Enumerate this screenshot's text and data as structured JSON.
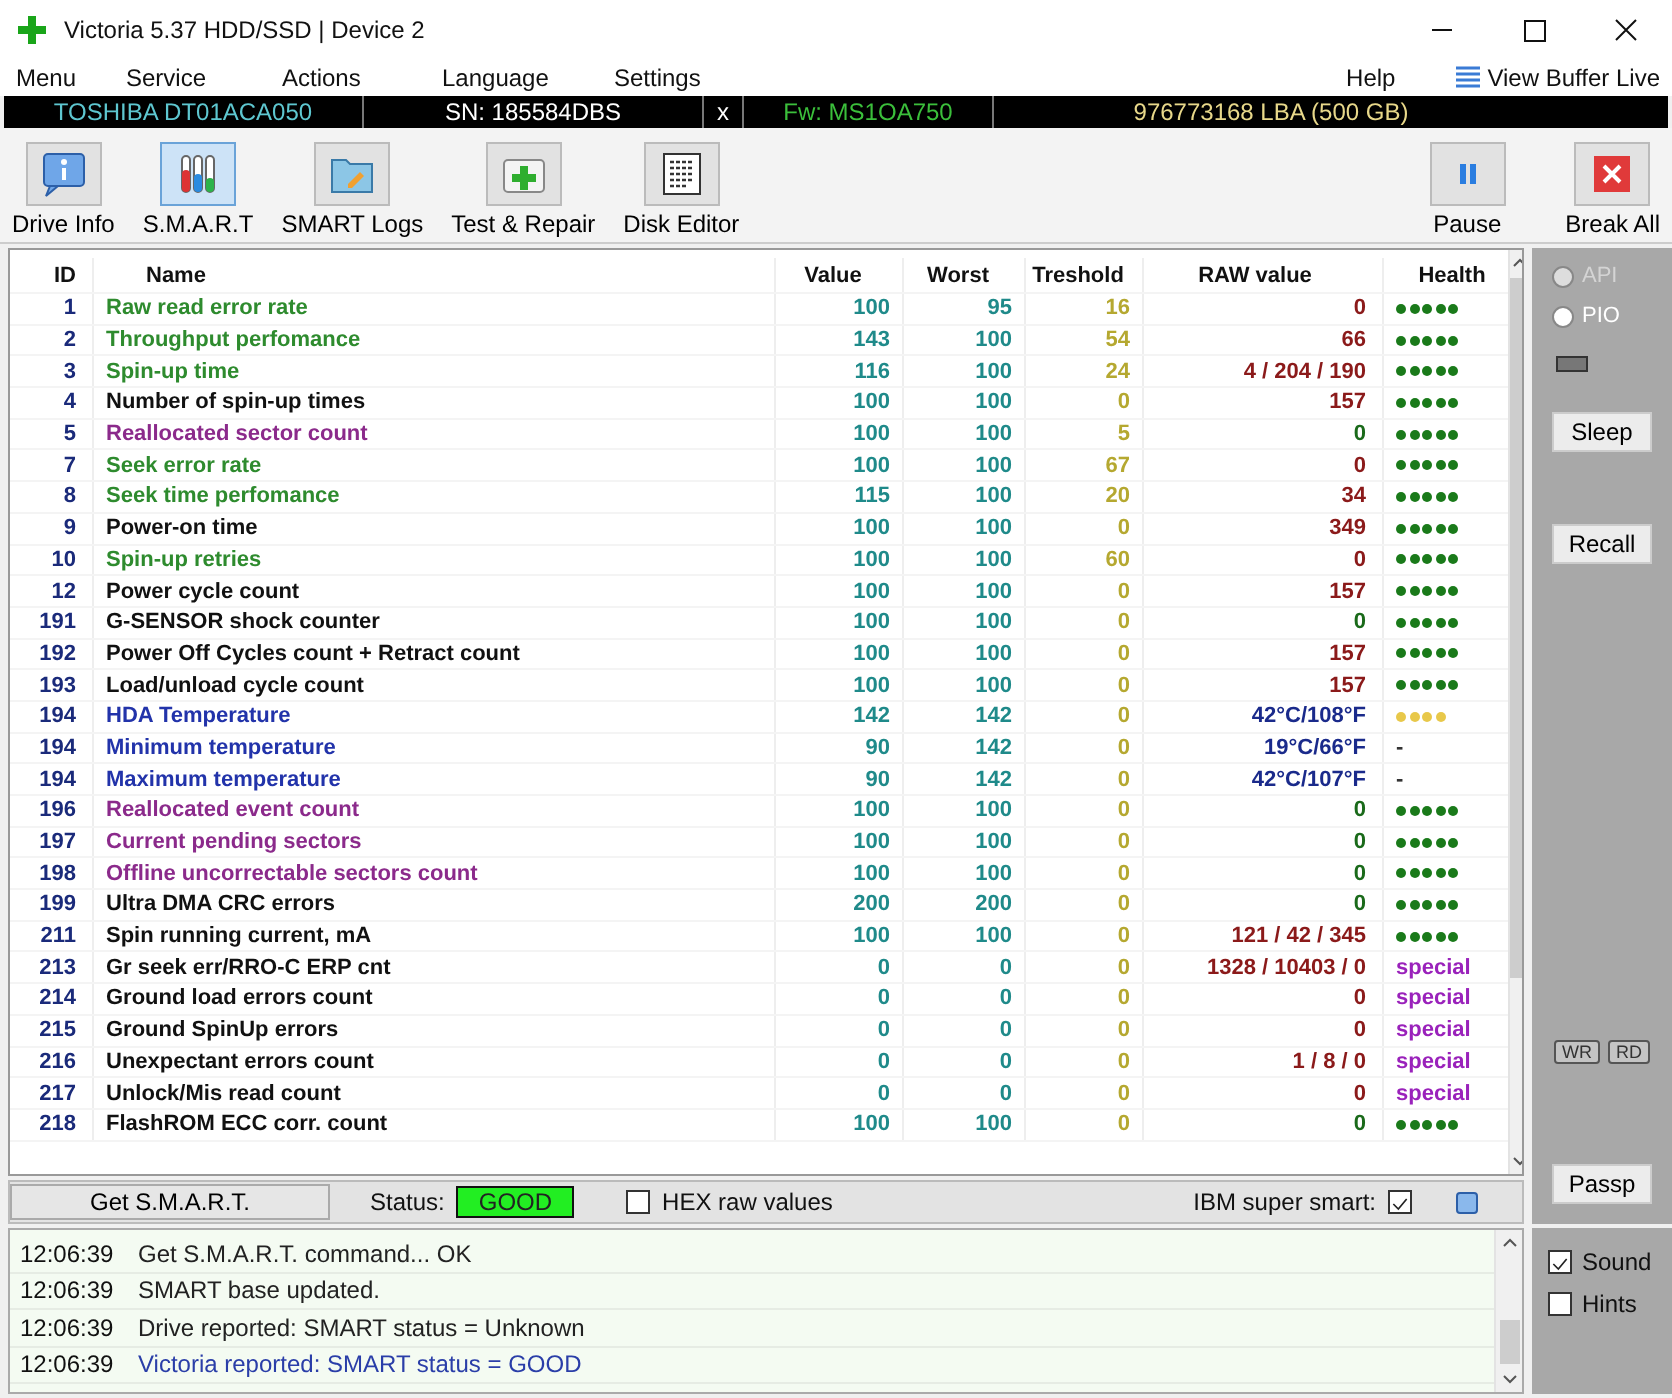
{
  "window": {
    "title": "Victoria 5.37 HDD/SSD | Device 2"
  },
  "menu": [
    "Menu",
    "Service",
    "Actions",
    "Language",
    "Settings"
  ],
  "menu_right": {
    "help": "Help",
    "view_buffer": "View Buffer Live"
  },
  "drive_bar": {
    "model": "TOSHIBA DT01ACA050",
    "serial": "SN: 185584DBS",
    "close": "x",
    "firmware": "Fw: MS1OA750",
    "capacity": "976773168 LBA (500 GB)"
  },
  "toolbar": [
    {
      "label": "Drive Info",
      "kind": "info",
      "selected": false
    },
    {
      "label": "S.M.A.R.T",
      "kind": "smart",
      "selected": true
    },
    {
      "label": "SMART Logs",
      "kind": "logs",
      "selected": false
    },
    {
      "label": "Test & Repair",
      "kind": "repair",
      "selected": false
    },
    {
      "label": "Disk Editor",
      "kind": "editor",
      "selected": false
    }
  ],
  "toolbar_right": [
    {
      "label": "Pause",
      "kind": "pause"
    },
    {
      "label": "Break All",
      "kind": "break"
    }
  ],
  "table": {
    "columns": [
      "ID",
      "Name",
      "Value",
      "Worst",
      "Treshold",
      "RAW value",
      "Health"
    ],
    "rows": [
      {
        "id": "1",
        "name": "Raw read error rate",
        "color": "#2e8b2e",
        "value": "100",
        "worst": "95",
        "threshold": "16",
        "raw": {
          "text": "0",
          "color": "#8b1a1a"
        },
        "health": {
          "kind": "dots",
          "stars": 5,
          "color": "#1a7a1a"
        }
      },
      {
        "id": "2",
        "name": "Throughput perfomance",
        "color": "#2e8b2e",
        "value": "143",
        "worst": "100",
        "threshold": "54",
        "raw": {
          "text": "66",
          "color": "#8b1a1a"
        },
        "health": {
          "kind": "dots",
          "stars": 5,
          "color": "#1a7a1a"
        }
      },
      {
        "id": "3",
        "name": "Spin-up time",
        "color": "#2e8b2e",
        "value": "116",
        "worst": "100",
        "threshold": "24",
        "raw": {
          "text": "4 / 204 / 190",
          "color": "#8b1a1a"
        },
        "health": {
          "kind": "dots",
          "stars": 5,
          "color": "#1a7a1a"
        }
      },
      {
        "id": "4",
        "name": "Number of spin-up times",
        "color": "#111111",
        "value": "100",
        "worst": "100",
        "threshold": "0",
        "raw": {
          "text": "157",
          "color": "#8b1a1a"
        },
        "health": {
          "kind": "dots",
          "stars": 5,
          "color": "#1a7a1a"
        }
      },
      {
        "id": "5",
        "name": "Reallocated sector count",
        "color": "#8b2a8b",
        "value": "100",
        "worst": "100",
        "threshold": "5",
        "raw": {
          "text": "0",
          "color": "#1a6a1a"
        },
        "health": {
          "kind": "dots",
          "stars": 5,
          "color": "#1a7a1a"
        }
      },
      {
        "id": "7",
        "name": "Seek error rate",
        "color": "#2e8b2e",
        "value": "100",
        "worst": "100",
        "threshold": "67",
        "raw": {
          "text": "0",
          "color": "#8b1a1a"
        },
        "health": {
          "kind": "dots",
          "stars": 5,
          "color": "#1a7a1a"
        }
      },
      {
        "id": "8",
        "name": "Seek time perfomance",
        "color": "#2e8b2e",
        "value": "115",
        "worst": "100",
        "threshold": "20",
        "raw": {
          "text": "34",
          "color": "#8b1a1a"
        },
        "health": {
          "kind": "dots",
          "stars": 5,
          "color": "#1a7a1a"
        }
      },
      {
        "id": "9",
        "name": "Power-on time",
        "color": "#111111",
        "value": "100",
        "worst": "100",
        "threshold": "0",
        "raw": {
          "text": "349",
          "color": "#8b1a1a"
        },
        "health": {
          "kind": "dots",
          "stars": 5,
          "color": "#1a7a1a"
        }
      },
      {
        "id": "10",
        "name": "Spin-up retries",
        "color": "#2e8b2e",
        "value": "100",
        "worst": "100",
        "threshold": "60",
        "raw": {
          "text": "0",
          "color": "#8b1a1a"
        },
        "health": {
          "kind": "dots",
          "stars": 5,
          "color": "#1a7a1a"
        }
      },
      {
        "id": "12",
        "name": "Power cycle count",
        "color": "#111111",
        "value": "100",
        "worst": "100",
        "threshold": "0",
        "raw": {
          "text": "157",
          "color": "#8b1a1a"
        },
        "health": {
          "kind": "dots",
          "stars": 5,
          "color": "#1a7a1a"
        }
      },
      {
        "id": "191",
        "name": "G-SENSOR shock counter",
        "color": "#111111",
        "value": "100",
        "worst": "100",
        "threshold": "0",
        "raw": {
          "text": "0",
          "color": "#1a6a1a"
        },
        "health": {
          "kind": "dots",
          "stars": 5,
          "color": "#1a7a1a"
        }
      },
      {
        "id": "192",
        "name": "Power Off Cycles count + Retract count",
        "color": "#111111",
        "value": "100",
        "worst": "100",
        "threshold": "0",
        "raw": {
          "text": "157",
          "color": "#8b1a1a"
        },
        "health": {
          "kind": "dots",
          "stars": 5,
          "color": "#1a7a1a"
        }
      },
      {
        "id": "193",
        "name": "Load/unload cycle count",
        "color": "#111111",
        "value": "100",
        "worst": "100",
        "threshold": "0",
        "raw": {
          "text": "157",
          "color": "#8b1a1a"
        },
        "health": {
          "kind": "dots",
          "stars": 5,
          "color": "#1a7a1a"
        }
      },
      {
        "id": "194",
        "name": "HDA Temperature",
        "color": "#2233aa",
        "value": "142",
        "worst": "142",
        "threshold": "0",
        "raw": {
          "text": "42°C/108°F",
          "color": "#1a2a8b"
        },
        "health": {
          "kind": "dots",
          "stars": 4,
          "color": "#e8c84a"
        }
      },
      {
        "id": "194",
        "name": "Minimum temperature",
        "color": "#2233aa",
        "value": "90",
        "worst": "142",
        "threshold": "0",
        "raw": {
          "text": "19°C/66°F",
          "color": "#1a2a8b"
        },
        "health": {
          "kind": "text",
          "text": "-",
          "color": "#333333"
        }
      },
      {
        "id": "194",
        "name": "Maximum temperature",
        "color": "#2233aa",
        "value": "90",
        "worst": "142",
        "threshold": "0",
        "raw": {
          "text": "42°C/107°F",
          "color": "#1a2a8b"
        },
        "health": {
          "kind": "text",
          "text": "-",
          "color": "#333333"
        }
      },
      {
        "id": "196",
        "name": "Reallocated event count",
        "color": "#8b2a8b",
        "value": "100",
        "worst": "100",
        "threshold": "0",
        "raw": {
          "text": "0",
          "color": "#1a6a1a"
        },
        "health": {
          "kind": "dots",
          "stars": 5,
          "color": "#1a7a1a"
        }
      },
      {
        "id": "197",
        "name": "Current pending sectors",
        "color": "#8b2a8b",
        "value": "100",
        "worst": "100",
        "threshold": "0",
        "raw": {
          "text": "0",
          "color": "#1a6a1a"
        },
        "health": {
          "kind": "dots",
          "stars": 5,
          "color": "#1a7a1a"
        }
      },
      {
        "id": "198",
        "name": "Offline uncorrectable sectors count",
        "color": "#8b2a8b",
        "value": "100",
        "worst": "100",
        "threshold": "0",
        "raw": {
          "text": "0",
          "color": "#1a6a1a"
        },
        "health": {
          "kind": "dots",
          "stars": 5,
          "color": "#1a7a1a"
        }
      },
      {
        "id": "199",
        "name": "Ultra DMA CRC errors",
        "color": "#111111",
        "value": "200",
        "worst": "200",
        "threshold": "0",
        "raw": {
          "text": "0",
          "color": "#1a6a1a"
        },
        "health": {
          "kind": "dots",
          "stars": 5,
          "color": "#1a7a1a"
        }
      },
      {
        "id": "211",
        "name": "Spin running current, mA",
        "color": "#111111",
        "value": "100",
        "worst": "100",
        "threshold": "0",
        "raw": {
          "text": "121 / 42 / 345",
          "color": "#8b1a1a"
        },
        "health": {
          "kind": "dots",
          "stars": 5,
          "color": "#1a7a1a"
        }
      },
      {
        "id": "213",
        "name": "Gr seek err/RRO-C ERP cnt",
        "color": "#111111",
        "value": "0",
        "worst": "0",
        "threshold": "0",
        "raw": {
          "text": "1328 / 10403 / 0",
          "color": "#8b1a1a"
        },
        "health": {
          "kind": "text",
          "text": "special",
          "color": "#9a22bb"
        }
      },
      {
        "id": "214",
        "name": "Ground load errors count",
        "color": "#111111",
        "value": "0",
        "worst": "0",
        "threshold": "0",
        "raw": {
          "text": "0",
          "color": "#8b1a1a"
        },
        "health": {
          "kind": "text",
          "text": "special",
          "color": "#9a22bb"
        }
      },
      {
        "id": "215",
        "name": "Ground SpinUp errors",
        "color": "#111111",
        "value": "0",
        "worst": "0",
        "threshold": "0",
        "raw": {
          "text": "0",
          "color": "#8b1a1a"
        },
        "health": {
          "kind": "text",
          "text": "special",
          "color": "#9a22bb"
        }
      },
      {
        "id": "216",
        "name": "Unexpectant errors count",
        "color": "#111111",
        "value": "0",
        "worst": "0",
        "threshold": "0",
        "raw": {
          "text": "1 / 8 / 0",
          "color": "#8b1a1a"
        },
        "health": {
          "kind": "text",
          "text": "special",
          "color": "#9a22bb"
        }
      },
      {
        "id": "217",
        "name": "Unlock/Mis read count",
        "color": "#111111",
        "value": "0",
        "worst": "0",
        "threshold": "0",
        "raw": {
          "text": "0",
          "color": "#8b1a1a"
        },
        "health": {
          "kind": "text",
          "text": "special",
          "color": "#9a22bb"
        }
      },
      {
        "id": "218",
        "name": "FlashROM ECC corr. count",
        "color": "#111111",
        "value": "100",
        "worst": "100",
        "threshold": "0",
        "raw": {
          "text": "0",
          "color": "#1a6a1a"
        },
        "health": {
          "kind": "dots",
          "stars": 5,
          "color": "#1a7a1a"
        }
      }
    ]
  },
  "status_row": {
    "button": "Get S.M.A.R.T.",
    "status_label": "Status:",
    "status": "GOOD",
    "hex": {
      "label": "HEX raw values",
      "checked": false
    },
    "ibm": {
      "label": "IBM super smart:",
      "checked": true
    }
  },
  "side_panel": {
    "radios": [
      {
        "label": "API",
        "selected": false,
        "disabled": true
      },
      {
        "label": "PIO",
        "selected": false,
        "disabled": false
      }
    ],
    "buttons": [
      "Sleep",
      "Recall"
    ],
    "indicators": [
      "WR",
      "RD"
    ],
    "passp": "Passp"
  },
  "log": [
    {
      "time": "12:06:39",
      "message": "Get S.M.A.R.T. command... OK",
      "kind": "normal"
    },
    {
      "time": "12:06:39",
      "message": "SMART base updated.",
      "kind": "normal"
    },
    {
      "time": "12:06:39",
      "message": "Drive reported: SMART status = Unknown",
      "kind": "normal"
    },
    {
      "time": "12:06:39",
      "message": "Victoria reported: SMART status = GOOD",
      "kind": "result"
    }
  ],
  "options": [
    {
      "label": "Sound",
      "checked": true
    },
    {
      "label": "Hints",
      "checked": false
    }
  ]
}
